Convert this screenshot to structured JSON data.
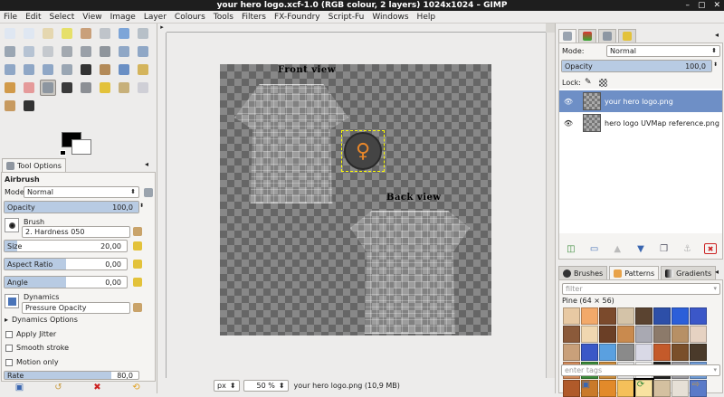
{
  "window": {
    "title": "your hero logo.xcf-1.0 (RGB colour, 2 layers) 1024x1024 – GIMP"
  },
  "menu": [
    "File",
    "Edit",
    "Select",
    "View",
    "Image",
    "Layer",
    "Colours",
    "Tools",
    "Filters",
    "FX-Foundry",
    "Script-Fu",
    "Windows",
    "Help"
  ],
  "tools": [
    {
      "name": "rect-select-icon",
      "color": "#dfe7f2"
    },
    {
      "name": "ellipse-select-icon",
      "color": "#dfe7f2"
    },
    {
      "name": "free-select-icon",
      "color": "#e5d7b0"
    },
    {
      "name": "fuzzy-select-icon",
      "color": "#e6e06a"
    },
    {
      "name": "color-select-icon",
      "color": "#c9a07a"
    },
    {
      "name": "scissors-icon",
      "color": "#bfc4ca"
    },
    {
      "name": "foreground-select-icon",
      "color": "#7da5d8"
    },
    {
      "name": "paths-icon",
      "color": "#b7c0c8"
    },
    {
      "name": "color-picker-icon",
      "color": "#9aa6b3"
    },
    {
      "name": "zoom-icon",
      "color": "#b6c3d3"
    },
    {
      "name": "measure-icon",
      "color": "#c5c9ce"
    },
    {
      "name": "move-icon",
      "color": "#a3a9b0"
    },
    {
      "name": "align-icon",
      "color": "#9aa0a8"
    },
    {
      "name": "crop-icon",
      "color": "#8f959c"
    },
    {
      "name": "rotate-icon",
      "color": "#8fa7c6"
    },
    {
      "name": "scale-icon",
      "color": "#8fa7c6"
    },
    {
      "name": "shear-icon",
      "color": "#8fa7c6"
    },
    {
      "name": "perspective-icon",
      "color": "#8fa7c6"
    },
    {
      "name": "flip-icon",
      "color": "#8fa7c6"
    },
    {
      "name": "cage-icon",
      "color": "#9aa6b3"
    },
    {
      "name": "text-icon",
      "color": "#333333"
    },
    {
      "name": "bucket-fill-icon",
      "color": "#b38a58"
    },
    {
      "name": "blend-icon",
      "color": "#6a8fc4"
    },
    {
      "name": "pencil-icon",
      "color": "#d4b45c"
    },
    {
      "name": "paintbrush-icon",
      "color": "#d19a4a"
    },
    {
      "name": "eraser-icon",
      "color": "#e59a9a"
    },
    {
      "name": "airbrush-icon",
      "color": "#8d96a0"
    },
    {
      "name": "ink-icon",
      "color": "#3a3a3a"
    },
    {
      "name": "clone-icon",
      "color": "#8c8f94"
    },
    {
      "name": "heal-icon",
      "color": "#e3c23a"
    },
    {
      "name": "perspective-clone-icon",
      "color": "#c7b07a"
    },
    {
      "name": "blur-icon",
      "color": "#cfcfd6"
    },
    {
      "name": "smudge-icon",
      "color": "#c79a60"
    },
    {
      "name": "dodge-burn-icon",
      "color": "#333333"
    }
  ],
  "tool_options": {
    "tab_label": "Tool Options",
    "tool_name": "Airbrush",
    "mode_label": "Mode:",
    "mode_value": "Normal",
    "opacity": {
      "label": "Opacity",
      "value": "100,0",
      "fraction": 1.0
    },
    "brush_label": "Brush",
    "brush_value": "2. Hardness 050",
    "size": {
      "label": "Size",
      "value": "20,00",
      "fraction": 0.1
    },
    "aspect": {
      "label": "Aspect Ratio",
      "value": "0,00",
      "fraction": 0.5
    },
    "angle": {
      "label": "Angle",
      "value": "0,00",
      "fraction": 0.5
    },
    "dynamics_label": "Dynamics",
    "dynamics_value": "Pressure Opacity",
    "dynamics_options": "Dynamics Options",
    "apply_jitter": "Apply Jitter",
    "smooth_stroke": "Smooth stroke",
    "motion_only": "Motion only",
    "rate": {
      "label": "Rate",
      "value": "80,0",
      "fraction": 0.8
    }
  },
  "canvas": {
    "front_label": "Front view",
    "back_label": "Back view"
  },
  "status": {
    "unit": "px",
    "zoom": "50 %",
    "info": "your hero logo.png (10,9 MB)"
  },
  "layers": {
    "mode_label": "Mode:",
    "mode_value": "Normal",
    "opacity": {
      "label": "Opacity",
      "value": "100,0",
      "fraction": 1.0
    },
    "lock_label": "Lock:",
    "items": [
      {
        "name": "your hero logo.png",
        "selected": true
      },
      {
        "name": "hero logo UVMap reference.png",
        "selected": false
      }
    ]
  },
  "patterns": {
    "tabs": [
      "Brushes",
      "Patterns",
      "Gradients"
    ],
    "filter_placeholder": "filter",
    "current": "Pine (64 × 56)",
    "tags_placeholder": "enter tags",
    "swatches": [
      "#e8c9a3",
      "#f2a96a",
      "#7b4a2c",
      "#d4c3a8",
      "#5a4330",
      "#2d4fa8",
      "#2c5fd9",
      "#3b57c8",
      "#8b5a3a",
      "#f0d7b0",
      "#6b3f26",
      "#c98a4e",
      "#a9a9b2",
      "#8c7a6a",
      "#b79065",
      "#e6d2c2",
      "#c9a07a",
      "#3a58c7",
      "#5aa0e0",
      "#8a8a8a",
      "#d9d9e6",
      "#c45a2a",
      "#7a4f2a",
      "#4a3a2a",
      "#d08a5a",
      "#3c8a3a",
      "#c98a3a",
      "#e0e0e0",
      "#f0f0f0",
      "#222222",
      "#9a9aa0",
      "#6e9ad4",
      "#b05a2a",
      "#c97a2a",
      "#e28a2a",
      "#f5c05a",
      "#f8e2a0",
      "#d4c0a0",
      "#e6e0d6",
      "#5a7ac8"
    ],
    "selected_index": 36
  },
  "colors": {
    "accent": "#6e8fc6",
    "fg": "#000000",
    "bg": "#ffffff"
  }
}
